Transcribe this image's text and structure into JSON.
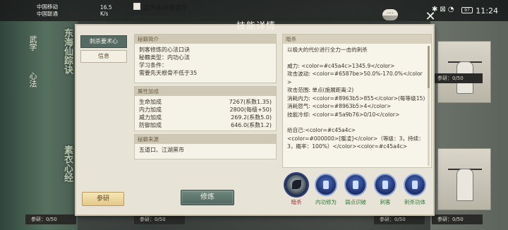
{
  "status_bar": {
    "carrier1": "中国移动",
    "carrier2": "中国联通",
    "speed": "16.5 K/s",
    "battery": "97",
    "time": "11:24"
  },
  "background": {
    "checkbox_label": "显示未获得武学",
    "left_tabs": [
      "武学",
      "心法"
    ],
    "left_brush_title_1": "东海仙踪诀",
    "left_brush_title_2": "素衣心经",
    "progress_tags": [
      "参研：0/50",
      "参研：0/50",
      "参研：0/50",
      "参研：0/50",
      "参研：0/50"
    ]
  },
  "dialog": {
    "title": "技能详情",
    "nav": [
      {
        "label": "刺杀要术心",
        "active": true
      },
      {
        "label": "信息",
        "active": false
      }
    ],
    "study_button": "参研",
    "practice_button": "修炼",
    "intro": {
      "heading": "秘籍简介",
      "lines": [
        "刺客修炼的心法口诀",
        "秘籍类型：内功心法",
        "学习条件：",
        "需要先天根骨不低于35"
      ]
    },
    "attributes": {
      "heading": "属性加成",
      "rows": [
        {
          "k": "生命加成",
          "v": "7267(系数1.35)"
        },
        {
          "k": "内力加成",
          "v": "2800(每级+50)"
        },
        {
          "k": "威力加成",
          "v": "269.2(系数5.0)"
        },
        {
          "k": "防御加成",
          "v": "646.0(系数1.2)"
        }
      ]
    },
    "source": {
      "heading": "秘籍来源",
      "text": "五道口、江湖黑市"
    },
    "description": {
      "heading": "暗杀",
      "lines": [
        "以极大的代价进行全力一击的刺杀",
        "",
        "威力: <color=#c45a4c>1345.9</color>",
        "攻击波动: <color=#6587be>50.0%-170.0%</color>",
        "攻击范围: 单点(施展距离:2)",
        "消耗内力: <color=#8963b5>855</color>(每等级15)",
        "消耗怒气: <color=#8963b5>4</color>",
        "技能冷却: <color=#5a9b76>0/10</color>",
        "",
        "给自己:<color=#c45a4c>",
        "<color=#000000>[暖凌]</color>（等级：3，持续：3，概率：100%）</color><color=#c45a4c>"
      ]
    },
    "skills": [
      {
        "label": "暗杀",
        "selected": true
      },
      {
        "label": "内功修为",
        "selected": false
      },
      {
        "label": "弱点识破",
        "selected": false
      },
      {
        "label": "刺客",
        "selected": false
      },
      {
        "label": "刺杀功体",
        "selected": false
      }
    ]
  }
}
